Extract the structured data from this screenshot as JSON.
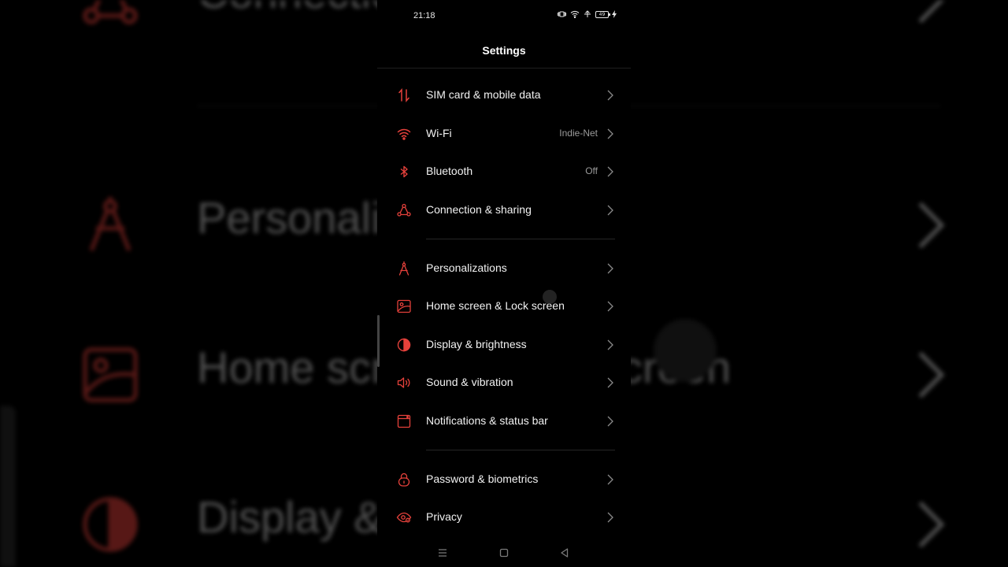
{
  "status_bar": {
    "time": "21:18",
    "battery": "49"
  },
  "header": {
    "title": "Settings"
  },
  "background": {
    "labels": [
      "Connectio",
      "Personali",
      "Home scr",
      "screen",
      "Display &"
    ]
  },
  "settings": [
    {
      "label": "SIM card & mobile data",
      "value": "",
      "icon": "sim-data-arrows-icon"
    },
    {
      "label": "Wi-Fi",
      "value": "Indie-Net",
      "icon": "wifi-icon"
    },
    {
      "label": "Bluetooth",
      "value": "Off",
      "icon": "bluetooth-icon"
    },
    {
      "label": "Connection & sharing",
      "value": "",
      "icon": "connection-sharing-icon"
    },
    {
      "label": "Personalizations",
      "value": "",
      "icon": "compass-icon"
    },
    {
      "label": "Home screen & Lock screen",
      "value": "",
      "icon": "wallpaper-icon"
    },
    {
      "label": "Display & brightness",
      "value": "",
      "icon": "contrast-icon"
    },
    {
      "label": "Sound & vibration",
      "value": "",
      "icon": "speaker-icon"
    },
    {
      "label": "Notifications & status bar",
      "value": "",
      "icon": "notification-icon"
    },
    {
      "label": "Password & biometrics",
      "value": "",
      "icon": "lock-icon"
    },
    {
      "label": "Privacy",
      "value": "",
      "icon": "privacy-eye-icon"
    }
  ],
  "colors": {
    "accent": "#e5413b",
    "background": "#000000",
    "text": "#f2f2f2",
    "secondary_text": "#9a9a9a"
  }
}
